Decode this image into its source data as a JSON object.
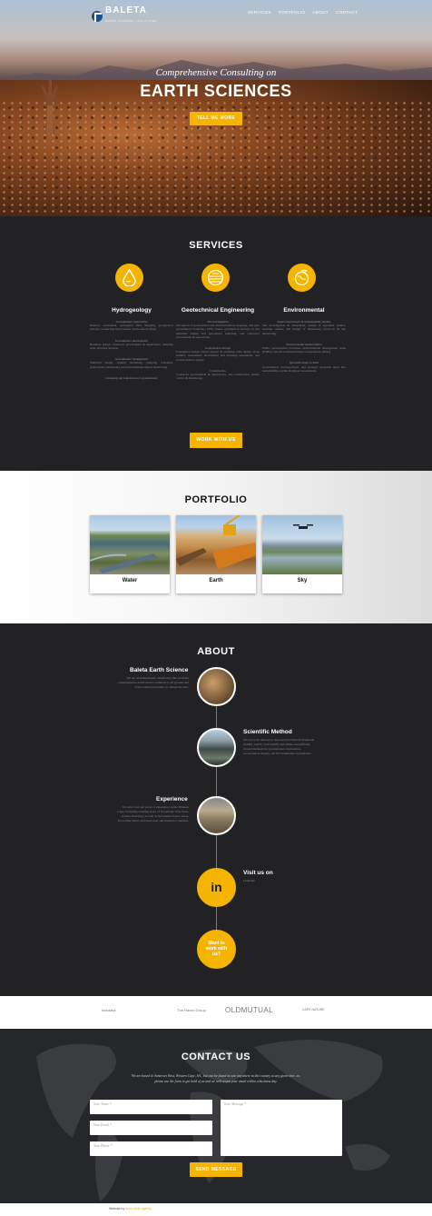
{
  "brand": {
    "name": "BALETA",
    "tagline": "EARTH SCIENCE · SOLUTIONS"
  },
  "nav": {
    "items": [
      "SERVICES",
      "PORTFOLIO",
      "ABOUT",
      "CONTACT"
    ]
  },
  "hero": {
    "subtitle": "Comprehensive Consulting on",
    "title": "EARTH SCIENCES",
    "cta": "TELL ME MORE"
  },
  "services": {
    "title": "SERVICES",
    "cta": "WORK WITH US",
    "icons": [
      "water-drop-icon",
      "globe-layers-icon",
      "earth-leaf-icon"
    ],
    "columns": [
      {
        "title": "Hydrogeology",
        "blocks": [
          {
            "sub": "Groundwater exploration",
            "text": "Desktop assessment, geological field mapping, geophysical surveys, conducting hydrocensus, and borehole siting."
          },
          {
            "sub": "Groundwater development",
            "text": "Borehole design, contractor procurement & supervision, pumping tests, and data analysis."
          },
          {
            "sub": "Groundwater management",
            "text": "Wellfield design, Aquifer modelling, pumping schedules, groundwater monitoring and environmental impact monitoring"
          },
          {
            "sub": "Licensing and registration of groundwater.",
            "text": ""
          }
        ]
      },
      {
        "title": "Geotechnical Engineering",
        "blocks": [
          {
            "sub": "Site investigation",
            "text": "All aspects of geotechnical site characterisation, mapping, trial pits, geotechnical boreholes, CPTs, Vanes, geophysical surveys, in situ materials testing and specialised sampling, and contractor procurement & supervision."
          },
          {
            "sub": "Geotechnical Design",
            "text": "Foundation design, lateral support & retaining walls design, slope stability assessment, de-watering and drainage assessment, and coastal defence design."
          },
          {
            "sub": "Construction",
            "text": "Contractor procurement & supervision, and construction quality control & monitoring."
          }
        ]
      },
      {
        "title": "Environmental",
        "blocks": [
          {
            "sub": "Impact Assessment & Sustainability Studies",
            "text": "Site investigation & assessment, design of specialist studies, baseline studies, and design of monitoring protocols & site monitoring."
          },
          {
            "sub": "Environmental Authorisation",
            "text": "Public participation processes, environmental management plans (EMPs), and environmental impact assessments (EIAs)."
          },
          {
            "sub": "Specialist Input to EIAs",
            "text": "Geotechnical, hydrogeologic, and geologic specialist input into sustainability studies & impact assessments."
          }
        ]
      }
    ]
  },
  "portfolio": {
    "title": "PORTFOLIO",
    "cards": [
      "Water",
      "Earth",
      "Sky"
    ]
  },
  "about": {
    "title": "ABOUT",
    "items": [
      {
        "title": "Baleta Earth Science",
        "text": "We are an independent consultancy that provides comprehensive earth science solutions to all ground and water related problems, no matter the size."
      },
      {
        "title": "Scientific Method",
        "text": "All our work adheres to the relevant National Standards (SABS, SANS, SACNASP) and utilise scientifically proven methods for groundwater exploration, Geotechnical design, and Environmental assessments."
      },
      {
        "title": "Experience",
        "text": "We have over ten years of experience in the Western Cape, including outlying areas of Swaziland, Free State, and the Overberg, as well as the interior Karoo areas, Kwa-Zulu Natal, and areas near sub-Saharan Countries."
      },
      {
        "title": "Visit us on",
        "text": "LinkedIn"
      }
    ],
    "linkedin": "in",
    "cta_lines": [
      "Want to",
      "work with",
      "us?"
    ]
  },
  "logos": [
    "Industria",
    "The Haven Group",
    "OLDMUTUAL",
    "CAPE NATURE"
  ],
  "contact": {
    "title": "CONTACT US",
    "blurb1": "We are based in Somerset West, Western Cape, SA., but can be found on site anywhere in the country at any given time, so,",
    "blurb2": "please use the form to get hold of us and we will return your email within a business day.",
    "name_ph": "Your Name *",
    "email_ph": "Your Email *",
    "phone_ph": "Your Phone *",
    "message_ph": "Your Message *",
    "send": "SEND MESSAGE"
  },
  "footer": {
    "prefix": "Website by",
    "link": "www.oxide.agency"
  },
  "colors": {
    "accent": "#f5b400",
    "dark": "#222225"
  }
}
